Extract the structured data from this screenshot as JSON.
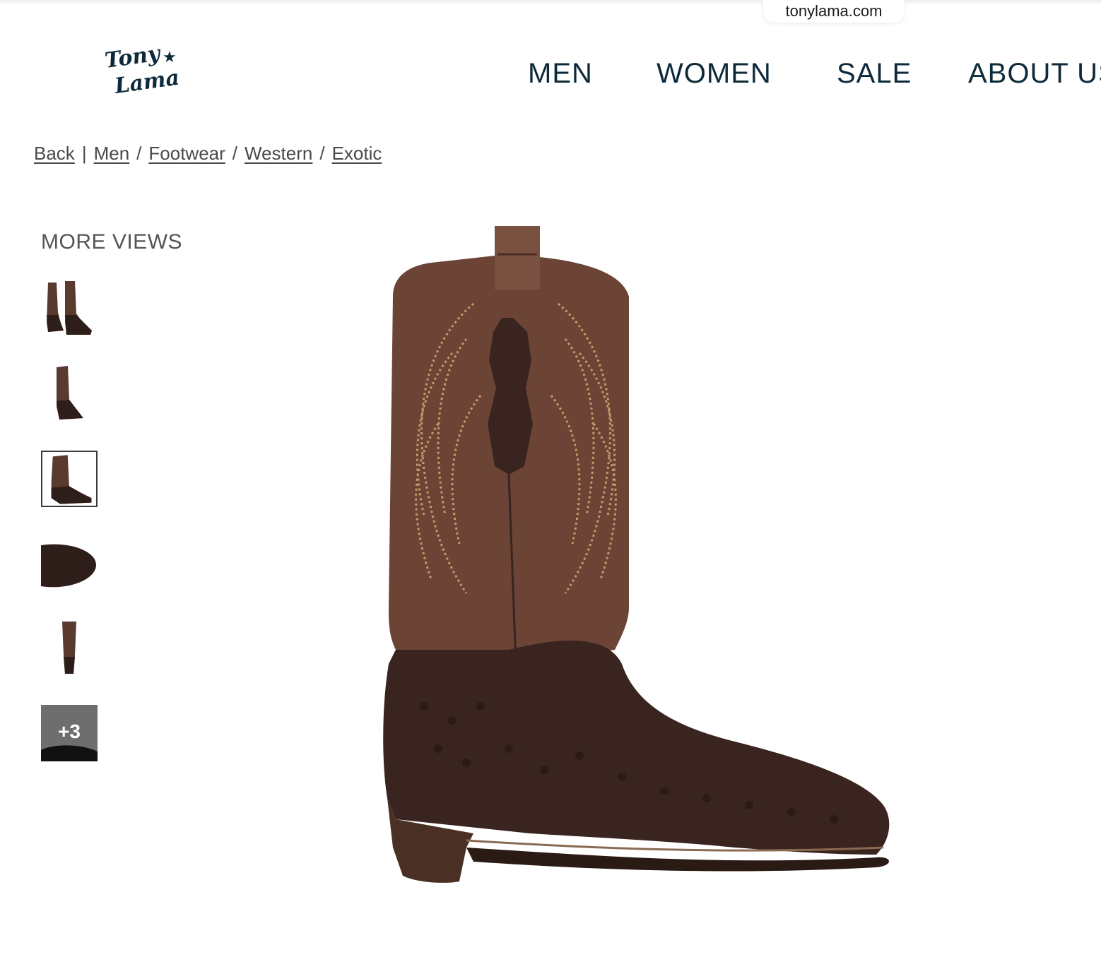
{
  "browser": {
    "url": "tonylama.com"
  },
  "header": {
    "logo": {
      "line1": "Tony",
      "line2": "Lama"
    },
    "nav": [
      "MEN",
      "WOMEN",
      "SALE",
      "ABOUT US"
    ]
  },
  "breadcrumb": {
    "back": "Back",
    "items": [
      "Men",
      "Footwear",
      "Western",
      "Exotic"
    ]
  },
  "gallery": {
    "heading": "MORE VIEWS",
    "more_count": "+3",
    "selected_index": 2
  },
  "colors": {
    "nav_text": "#0e2a3a",
    "boot_shaft": "#6b4436",
    "boot_foot": "#3a2420",
    "stitching": "#c99a6a"
  }
}
